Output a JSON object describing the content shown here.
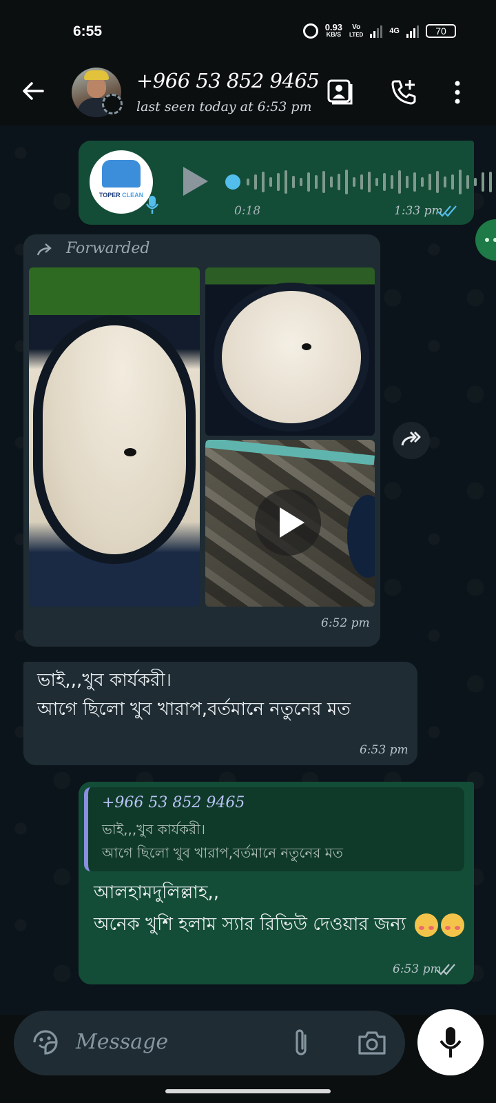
{
  "status_bar": {
    "time": "6:55",
    "net_speed_top": "0.93",
    "net_speed_bottom": "KB/S",
    "volte_top": "Vo",
    "volte_bottom": "LTED",
    "network": "4G",
    "battery": "70"
  },
  "header": {
    "contact_name": "+966 53 852 9465",
    "last_seen": "last seen today at 6:53 pm"
  },
  "messages": {
    "audio": {
      "brand_left": "TOPER",
      "brand_right": "CLEAN",
      "duration": "0:18",
      "time": "1:33 pm"
    },
    "media": {
      "forwarded_label": "Forwarded",
      "time": "6:52 pm"
    },
    "incoming_text": {
      "line1": "ভাই,,,খুব কার্যকরী।",
      "line2": "আগে ছিলো খুব খারাপ,বর্তমানে নতুনের মত",
      "time": "6:53 pm"
    },
    "reply": {
      "quote_name": "+966 53 852 9465",
      "quote_line1": "ভাই,,,খুব কার্যকরী।",
      "quote_line2": "আগে ছিলো খুব খারাপ,বর্তমানে নতুনের মত",
      "line1": "আলহামদুলিল্লাহ,,",
      "line2": "অনেক খুশি হলাম স্যার রিভিউ দেওয়ার জন্য",
      "time": "6:53 pm"
    }
  },
  "composer": {
    "placeholder": "Message"
  },
  "colors": {
    "outgoing_bubble": "#144d37",
    "incoming_bubble": "#1f2c34",
    "read_ticks": "#53bdeb",
    "app_background": "#0b141a"
  }
}
